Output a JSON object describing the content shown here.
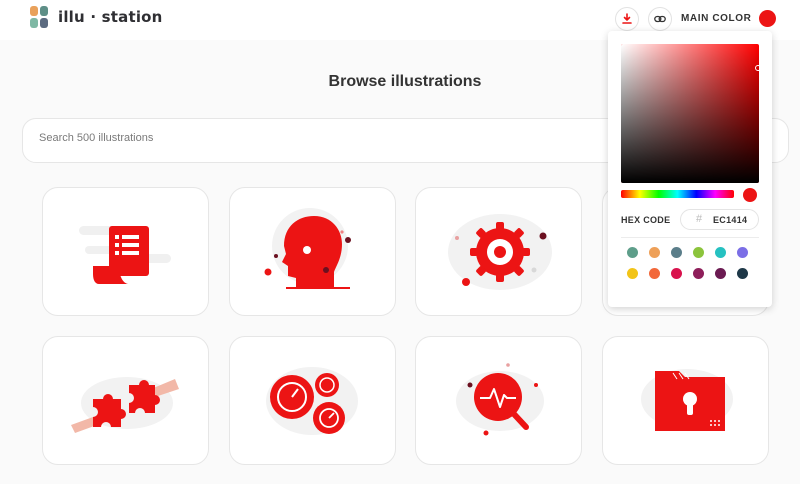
{
  "app": {
    "logo_text": "illu · station",
    "logo_colors": [
      "#E9A15B",
      "#5E8F87",
      "#5C6B80",
      "#7FB8A4"
    ]
  },
  "toolbar": {
    "download_icon": "download-icon",
    "link_icon": "link-icon",
    "main_color_label": "MAIN COLOR",
    "main_color": "#EC1414"
  },
  "page": {
    "title": "Browse illustrations"
  },
  "search": {
    "placeholder": "Search 500 illustrations",
    "value": ""
  },
  "cards": [
    {
      "icon": "document-list-icon"
    },
    {
      "icon": "head-profile-icon"
    },
    {
      "icon": "virus-icon"
    },
    {
      "icon": "hidden-illustration"
    },
    {
      "icon": "puzzle-hands-icon"
    },
    {
      "icon": "gauges-icon"
    },
    {
      "icon": "search-pulse-icon"
    },
    {
      "icon": "locked-folder-icon"
    }
  ],
  "color_picker": {
    "hex_label": "HEX CODE",
    "hex_hash": "#",
    "hex_value": "EC1414",
    "current_color": "#EC1414",
    "presets": [
      "#5E9E8A",
      "#EEA058",
      "#5B7E8A",
      "#8CC43C",
      "#26C1C1",
      "#7B6EE6",
      "#F2C418",
      "#F2683A",
      "#D9124D",
      "#8E1E5A",
      "#6B1B52",
      "#1E3848"
    ]
  }
}
